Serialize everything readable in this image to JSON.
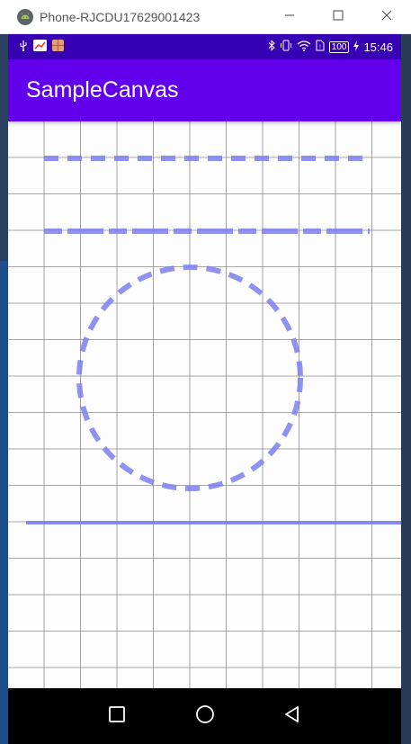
{
  "window": {
    "title": "Phone-RJCDU17629001423",
    "icon": "android-icon",
    "buttons": [
      "minimize-icon",
      "maximize-icon",
      "close-icon"
    ]
  },
  "status_bar": {
    "time": "15:46",
    "battery": "100",
    "background": "#3700b3",
    "icons": [
      "usb-icon",
      "chart-icon",
      "gift-icon",
      "bluetooth-icon",
      "vibrate-icon",
      "wifi-icon",
      "sim-icon",
      "battery-icon",
      "charging-icon"
    ]
  },
  "app_bar": {
    "title": "SampleCanvas",
    "background": "#6200ee"
  },
  "canvas": {
    "grid_color": "#8a8a8a",
    "stroke_color": "#7b7ff0",
    "shapes": [
      "short-dashed-line",
      "long-dashed-line",
      "dashed-circle",
      "solid-line"
    ]
  },
  "nav_bar": {
    "buttons": [
      "recents-button",
      "home-button",
      "back-button"
    ]
  }
}
